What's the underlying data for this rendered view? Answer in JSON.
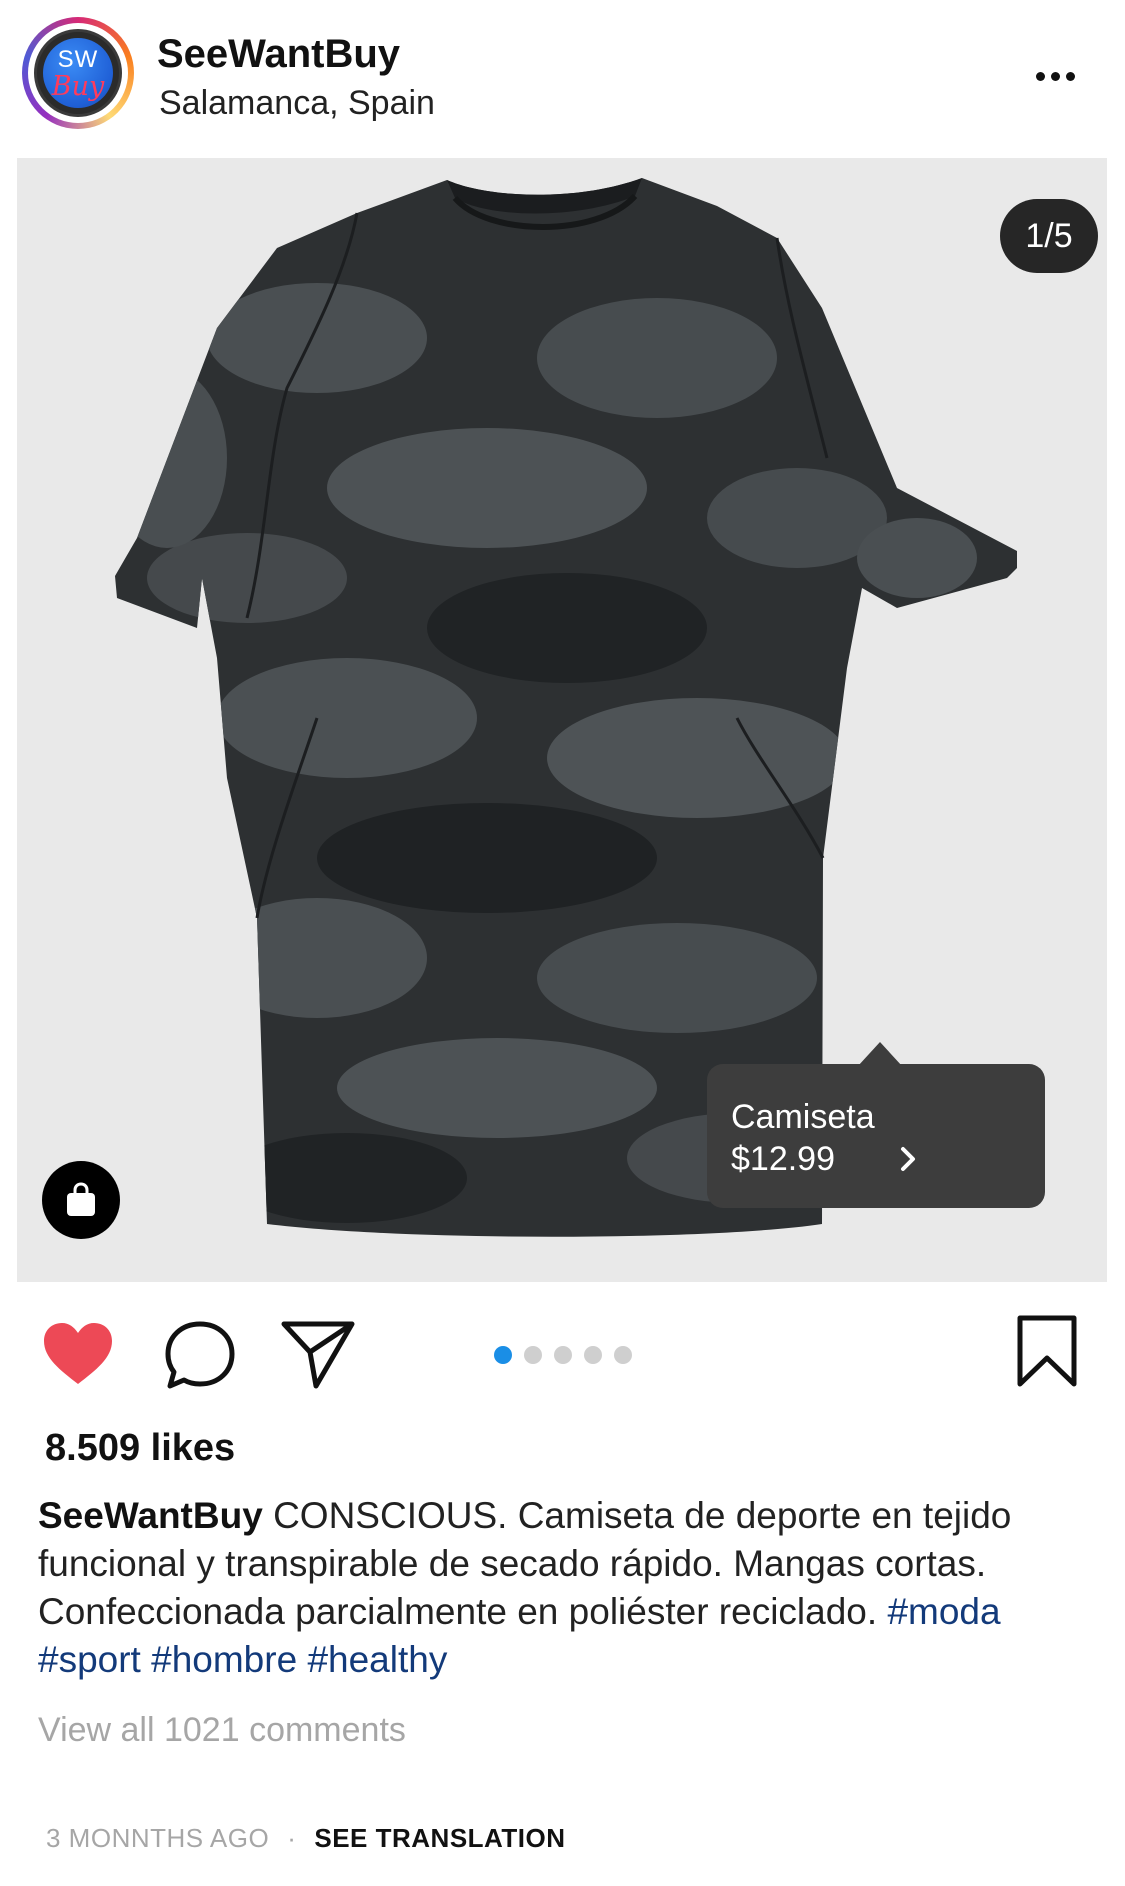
{
  "header": {
    "account_name": "SeeWantBuy",
    "location": "Salamanca, Spain",
    "avatar_text_top": "SW",
    "avatar_text_bottom": "Buy"
  },
  "media": {
    "page_counter": "1/5",
    "current_page": 1,
    "total_pages": 5,
    "product_tag": {
      "name": "Camiseta",
      "price": "$12.99"
    }
  },
  "actions": {
    "liked": true,
    "like_color": "#ed4956",
    "active_dot_color": "#1a8ee6"
  },
  "post": {
    "likes": "8.509 likes",
    "caption_author": "SeeWantBuy",
    "caption_text": "CONSCIOUS. Camiseta de deporte en tejido funcional y transpirable de secado rápido. Mangas cortas. Confeccionada parcialmente en poliéster reciclado.",
    "hashtags": [
      "#moda",
      "#sport",
      "#hombre",
      "#healthy"
    ],
    "view_comments": "View all 1021 comments",
    "time_ago": "3 MONNTHS AGO",
    "separator": "·",
    "see_translation": "SEE TRANSLATION"
  },
  "icons": {
    "more": "more-horizontal-icon",
    "shop": "shopping-bag-icon",
    "chevron": "chevron-right-icon",
    "like": "heart-icon",
    "comment": "comment-icon",
    "share": "send-icon",
    "save": "bookmark-icon"
  }
}
